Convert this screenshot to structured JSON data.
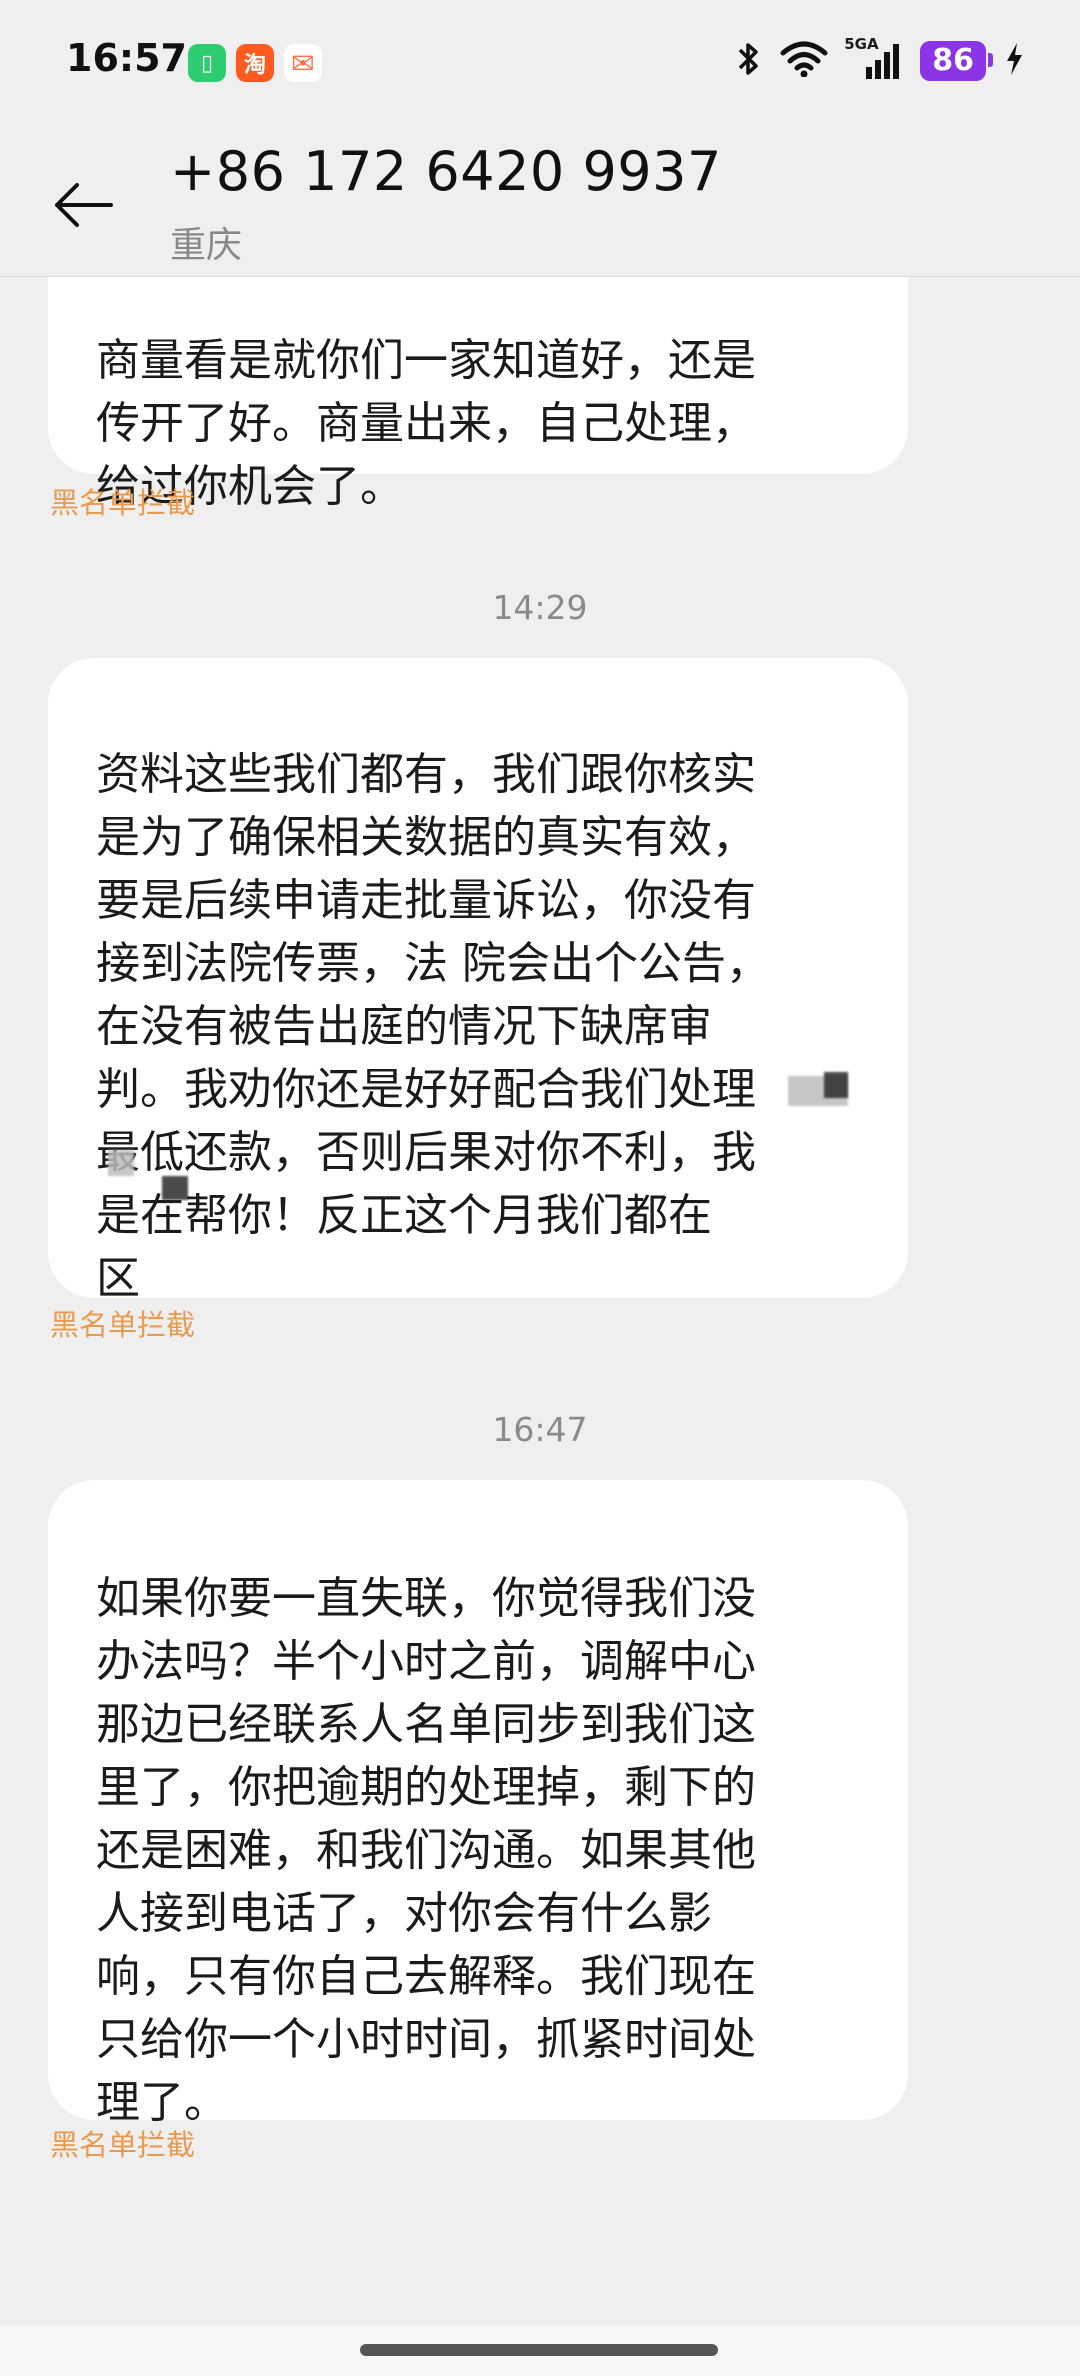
{
  "status_bar": {
    "time": "16:57",
    "apps": [
      {
        "icon": "battery-saver-app-icon",
        "color": "#2ecc71",
        "glyph": "▯"
      },
      {
        "icon": "taobao-app-icon",
        "color": "#ff5a1f",
        "glyph": "淘"
      },
      {
        "icon": "mail-app-icon",
        "color": "#ff7043",
        "glyph": "✉"
      }
    ],
    "network": "5GA",
    "battery": "86"
  },
  "header": {
    "contact_number": "+86 172 6420 9937",
    "location": "重庆"
  },
  "messages": [
    {
      "text": "商量看是就你们一家知道好，还是\n传开了好。商量出来，自己处理，\n给过你机会了。",
      "label": "黑名单拦截"
    },
    {
      "timestamp": "14:29",
      "text": "资料这些我们都有，我们跟你核实\n是为了确保相关数据的真实有效，\n要是后续申请走批量诉讼，你没有\n接到法院传票，法 院会出个公告，\n在没有被告出庭的情况下缺席审\n判。我劝你还是好好配合我们处理\n最低还款，否则后果对你不利，我\n是在帮你！反正这个月我们都在\n  区",
      "label": "黑名单拦截"
    },
    {
      "timestamp": "16:47",
      "text": "如果你要一直失联，你觉得我们没\n办法吗？半个小时之前，调解中心\n那边已经联系人名单同步到我们这\n里了，你把逾期的处理掉，剩下的\n还是困难，和我们沟通。如果其他\n人接到电话了，对你会有什么影\n响，只有你自己去解释。我们现在\n只给你一个小时时间，抓紧时间处\n理了。",
      "label": "黑名单拦截"
    }
  ],
  "colors": {
    "background": "#efefef",
    "bubble": "#ffffff",
    "block_label": "#e89a4e",
    "battery": "#8b35e6"
  }
}
